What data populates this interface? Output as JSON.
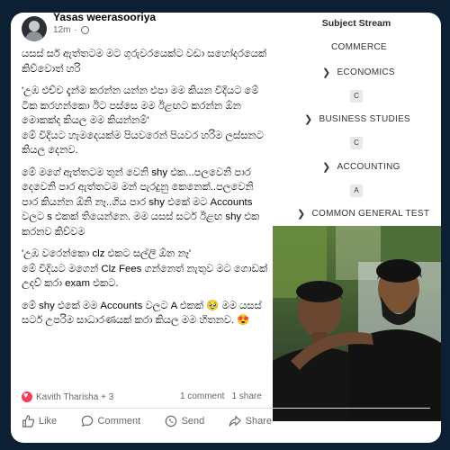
{
  "post": {
    "author": "Yasas weerasooriya",
    "time": "12m",
    "paragraphs": [
      "යසස් සර් ඇත්තටම මට ගුරුවරයෙක්ට වඩා සහෝදරයෙක් කිව්වොත් හරි",
      "'උඹ එච්ච දැන්ම කරන්න යන්න එපා මම කියන විදියට මේ ටික කරහන්කො ඊට පස්සෙ මම ඊළඟට කරන්න ඕන මොකක්ද කියල මම කියන්නම්'",
      "මේ විදියට හැමදෙයක්ම පියවරෙන් පියවර හරිම ලස්සනට කියල දෙනව.",
      "මේ මගේ ඇත්තටම තුන් වෙනි shy එක...පලවෙනි පාර දෙවෙනි පාර ඇත්තටම මන් පැරදුනු කෙනෙක්..පලවෙනි පාර කියන්න ඕනි නෑ..ගිය පාර shy එකේ මට Accounts වලට s එකක් තියෙන්නෙ. මම යසස් සර්ට ඊළඟ shy එක කරනව කිව්වම",
      "'උඹ වරෙන්කො clz එකට සල්ලි ඕන නෑ'",
      "මේ විදියට මගෙන් Clz Fees ගන්නෙත් නැතුව මට ගොඩක් උදව් කරා exam එකට.",
      "මේ shy එකේ මම Accounts වලට A එකක් 🥹 මම යසස් සර්ට උපරිම සාධාරණයක් කරා කියල මම හිතනව. 😍"
    ]
  },
  "stream": {
    "title": "Subject Stream",
    "items": [
      "COMMERCE",
      "ECONOMICS",
      "BUSINESS STUDIES",
      "ACCOUNTING",
      "COMMON GENERAL TEST"
    ],
    "grades": [
      "C",
      "C",
      "A"
    ]
  },
  "engagement": {
    "reactors": "Kavith Tharisha + 3",
    "comments": "1 comment",
    "shares": "1 share"
  },
  "actions": {
    "like": "Like",
    "comment": "Comment",
    "send": "Send",
    "share": "Share"
  },
  "colors": {
    "background": "#0d1f33",
    "card": "#ffffff",
    "text": "#050505",
    "muted": "#65676b"
  }
}
